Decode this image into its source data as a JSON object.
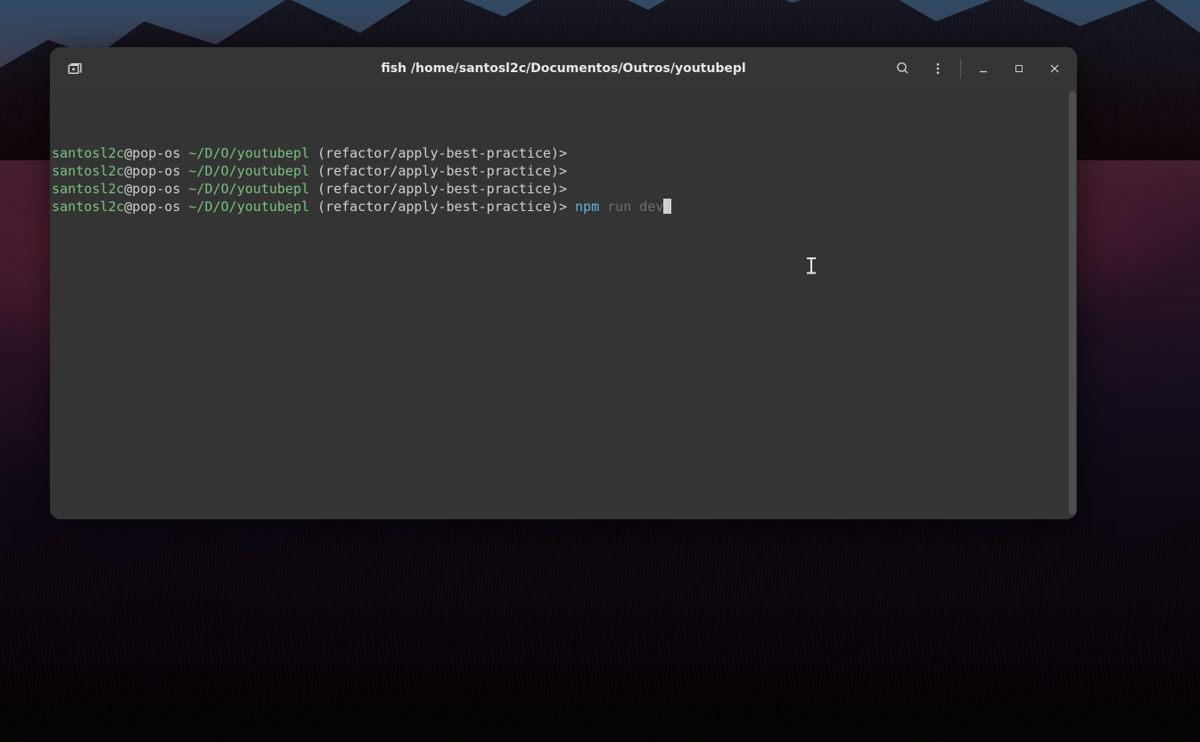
{
  "colors": {
    "window_bg": "#2b2b2b",
    "titlebar_bg": "#353535",
    "body_bg": "#343434",
    "fg": "#cfcfcf",
    "user_green": "#7ac27e",
    "cmd_blue": "#5fb4e0",
    "suggest_grey": "#6f6f6f"
  },
  "window": {
    "title": "fish /home/santosl2c/Documentos/Outros/youtubepl"
  },
  "titlebar_icons": {
    "new_tab": "new-tab-icon",
    "search": "search-icon",
    "menu": "menu-icon",
    "minimize": "minimize-icon",
    "maximize": "maximize-icon",
    "close": "close-icon"
  },
  "prompt": {
    "user": "santosl2c",
    "at": "@",
    "host": "pop-os",
    "path": "~/D/O/youtubepl",
    "branch": "(refactor/apply-best-practice)",
    "marker": ">"
  },
  "lines": [
    {
      "command_typed": "",
      "suggestion": ""
    },
    {
      "command_typed": "",
      "suggestion": ""
    },
    {
      "command_typed": "",
      "suggestion": ""
    },
    {
      "command_typed": "npm",
      "suggestion": " run dev",
      "cursor": true
    }
  ]
}
